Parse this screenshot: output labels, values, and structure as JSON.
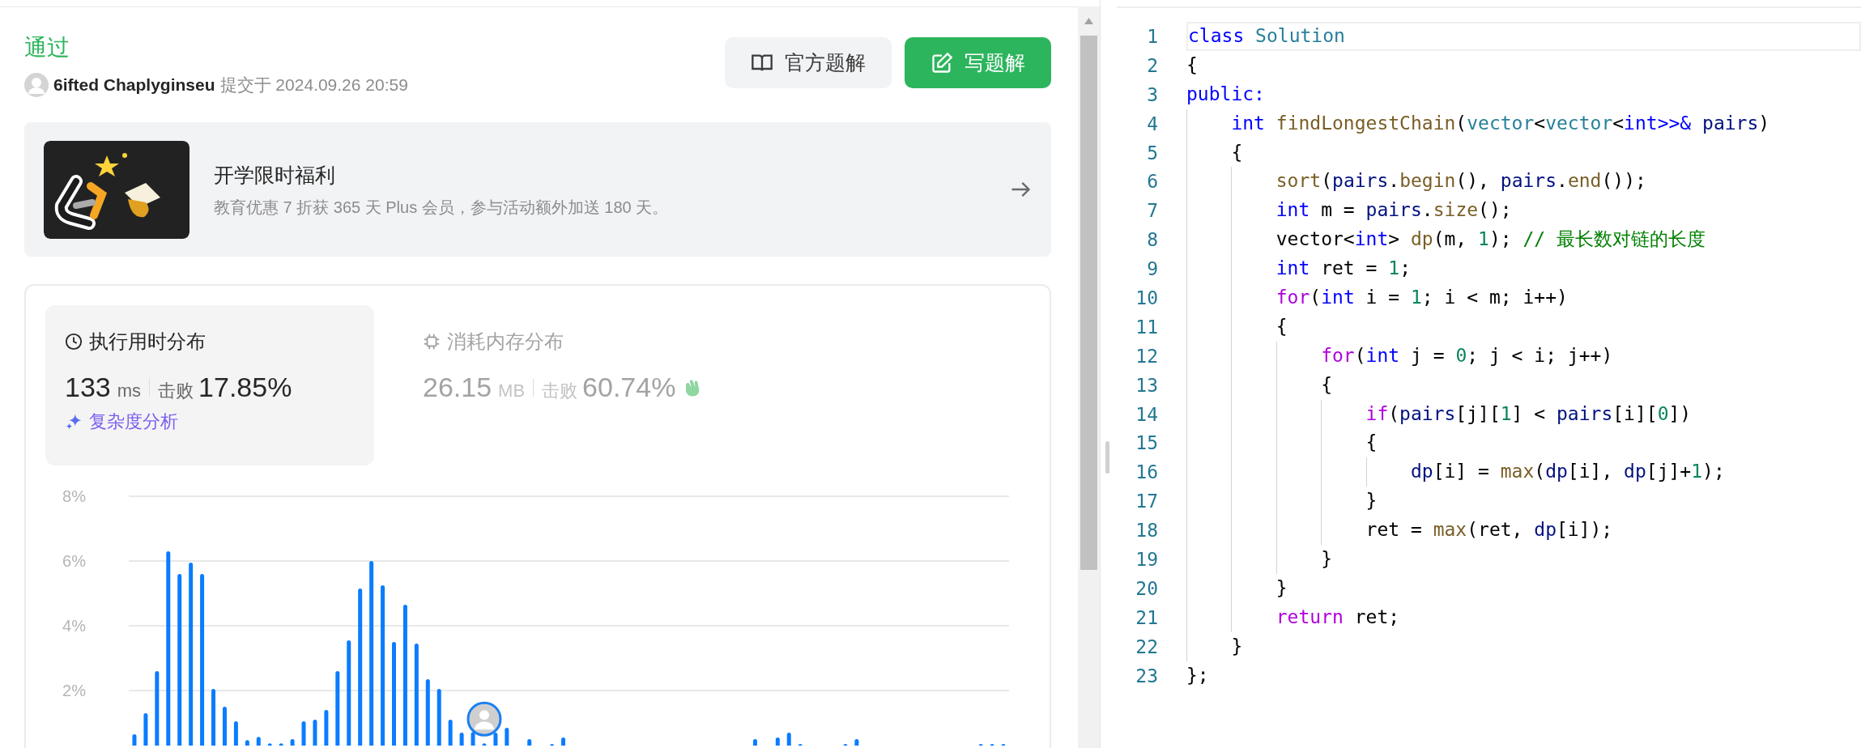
{
  "status": "通过",
  "submission": {
    "user": "6ifted Chaplyginseu",
    "submitted": "提交于 2024.09.26 20:59"
  },
  "actions": [
    {
      "label": "官方题解",
      "kind": "secondary"
    },
    {
      "label": "写题解",
      "kind": "primary"
    }
  ],
  "promo": {
    "kind": "picture",
    "title": "开学限时福利",
    "subtitle": "教育优惠 7 折获 365 天 Plus 会员，参与活动额外加送 180 天。"
  },
  "metrics": [
    {
      "kind": "runtime",
      "title": "执行用时分布",
      "selected": true,
      "value": "133",
      "unit": "ms",
      "beats_label": "击败",
      "beats": "17.85%",
      "link": "复杂度分析"
    },
    {
      "kind": "memory",
      "title": "消耗内存分布",
      "selected": false,
      "value": "26.15",
      "unit": "MB",
      "beats_label": "击败",
      "beats": "60.74%"
    }
  ],
  "distribution": {
    "chart_data": {
      "type": "bar",
      "values": [
        0.65,
        1.3,
        2.6,
        6.3,
        5.6,
        5.95,
        5.6,
        2.05,
        1.5,
        1.05,
        0.47,
        0.57,
        0.37,
        0.37,
        0.5,
        1.05,
        1.1,
        1.4,
        2.6,
        3.55,
        5.15,
        6.0,
        5.25,
        3.5,
        4.65,
        3.45,
        2.35,
        2.05,
        1.1,
        0.7,
        0.72,
        0.37,
        0.7,
        0.85,
        null,
        0.5,
        null,
        0.35,
        0.55,
        null,
        null,
        null,
        null,
        null,
        null,
        null,
        null,
        null,
        null,
        null,
        null,
        null,
        null,
        null,
        null,
        0.5,
        null,
        0.55,
        0.7,
        0.35,
        null,
        null,
        null,
        0.35,
        0.5,
        null,
        null,
        null,
        null,
        null,
        null,
        null,
        null,
        null,
        null,
        0.35,
        0.35,
        0.35
      ],
      "ylim": [
        0,
        8
      ],
      "yticks": [
        {
          "value": 2,
          "label": "2%"
        },
        {
          "value": 4,
          "label": "4%"
        },
        {
          "value": 6,
          "label": "6%"
        },
        {
          "value": 8,
          "label": "8%"
        }
      ],
      "grid": true
    }
  },
  "code": {
    "lines": [
      {
        "number": "1",
        "current": true,
        "tokens": [
          {
            "text": "class",
            "kind": "keyword"
          },
          {
            "text": " Solution",
            "kind": "type"
          }
        ]
      },
      {
        "number": "2",
        "current": false,
        "tokens": [
          {
            "text": "{",
            "kind": "plain"
          }
        ]
      },
      {
        "number": "3",
        "current": false,
        "tokens": [
          {
            "text": "public:",
            "kind": "keyword"
          }
        ]
      },
      {
        "number": "4",
        "current": false,
        "tokens": [
          {
            "text": "    int",
            "kind": "keyword"
          },
          {
            "text": " findLongestChain",
            "kind": "function"
          },
          {
            "text": "(",
            "kind": "plain"
          },
          {
            "text": "vector",
            "kind": "type"
          },
          {
            "text": "<",
            "kind": "plain"
          },
          {
            "text": "vector",
            "kind": "type"
          },
          {
            "text": "<",
            "kind": "plain"
          },
          {
            "text": "int",
            "kind": "keyword"
          },
          {
            "text": ">>& ",
            "kind": "keyword"
          },
          {
            "text": "pairs",
            "kind": "variable"
          },
          {
            "text": ")",
            "kind": "plain"
          }
        ]
      },
      {
        "number": "5",
        "current": false,
        "tokens": [
          {
            "text": "    {",
            "kind": "plain"
          }
        ]
      },
      {
        "number": "6",
        "current": false,
        "tokens": [
          {
            "text": "        sort",
            "kind": "function"
          },
          {
            "text": "(",
            "kind": "plain"
          },
          {
            "text": "pairs",
            "kind": "variable"
          },
          {
            "text": ".",
            "kind": "plain"
          },
          {
            "text": "begin",
            "kind": "function"
          },
          {
            "text": "(), ",
            "kind": "plain"
          },
          {
            "text": "pairs",
            "kind": "variable"
          },
          {
            "text": ".",
            "kind": "plain"
          },
          {
            "text": "end",
            "kind": "function"
          },
          {
            "text": "());",
            "kind": "plain"
          }
        ]
      },
      {
        "number": "7",
        "current": false,
        "tokens": [
          {
            "text": "        int",
            "kind": "keyword"
          },
          {
            "text": " m = ",
            "kind": "plain"
          },
          {
            "text": "pairs",
            "kind": "variable"
          },
          {
            "text": ".",
            "kind": "plain"
          },
          {
            "text": "size",
            "kind": "function"
          },
          {
            "text": "();",
            "kind": "plain"
          }
        ]
      },
      {
        "number": "8",
        "current": false,
        "tokens": [
          {
            "text": "        vector<",
            "kind": "plain"
          },
          {
            "text": "int",
            "kind": "keyword"
          },
          {
            "text": "> ",
            "kind": "plain"
          },
          {
            "text": "dp",
            "kind": "function"
          },
          {
            "text": "(m, ",
            "kind": "plain"
          },
          {
            "text": "1",
            "kind": "number"
          },
          {
            "text": "); ",
            "kind": "plain"
          },
          {
            "text": "// 最长数对链的长度",
            "kind": "comment"
          }
        ]
      },
      {
        "number": "9",
        "current": false,
        "tokens": [
          {
            "text": "        int",
            "kind": "keyword"
          },
          {
            "text": " ret = ",
            "kind": "plain"
          },
          {
            "text": "1",
            "kind": "number"
          },
          {
            "text": ";",
            "kind": "plain"
          }
        ]
      },
      {
        "number": "10",
        "current": false,
        "tokens": [
          {
            "text": "        for",
            "kind": "control"
          },
          {
            "text": "(",
            "kind": "plain"
          },
          {
            "text": "int",
            "kind": "keyword"
          },
          {
            "text": " i = ",
            "kind": "plain"
          },
          {
            "text": "1",
            "kind": "number"
          },
          {
            "text": "; i < m; i++)",
            "kind": "plain"
          }
        ]
      },
      {
        "number": "11",
        "current": false,
        "tokens": [
          {
            "text": "        {",
            "kind": "plain"
          }
        ]
      },
      {
        "number": "12",
        "current": false,
        "tokens": [
          {
            "text": "            for",
            "kind": "control"
          },
          {
            "text": "(",
            "kind": "plain"
          },
          {
            "text": "int",
            "kind": "keyword"
          },
          {
            "text": " j = ",
            "kind": "plain"
          },
          {
            "text": "0",
            "kind": "number"
          },
          {
            "text": "; j < i; j++)",
            "kind": "plain"
          }
        ]
      },
      {
        "number": "13",
        "current": false,
        "tokens": [
          {
            "text": "            {",
            "kind": "plain"
          }
        ]
      },
      {
        "number": "14",
        "current": false,
        "tokens": [
          {
            "text": "                if",
            "kind": "control"
          },
          {
            "text": "(",
            "kind": "plain"
          },
          {
            "text": "pairs",
            "kind": "variable"
          },
          {
            "text": "[j][",
            "kind": "plain"
          },
          {
            "text": "1",
            "kind": "number"
          },
          {
            "text": "] < ",
            "kind": "plain"
          },
          {
            "text": "pairs",
            "kind": "variable"
          },
          {
            "text": "[i][",
            "kind": "plain"
          },
          {
            "text": "0",
            "kind": "number"
          },
          {
            "text": "])",
            "kind": "plain"
          }
        ]
      },
      {
        "number": "15",
        "current": false,
        "tokens": [
          {
            "text": "                {",
            "kind": "plain"
          }
        ]
      },
      {
        "number": "16",
        "current": false,
        "tokens": [
          {
            "text": "                    dp",
            "kind": "variable"
          },
          {
            "text": "[i] = ",
            "kind": "plain"
          },
          {
            "text": "max",
            "kind": "function"
          },
          {
            "text": "(",
            "kind": "plain"
          },
          {
            "text": "dp",
            "kind": "variable"
          },
          {
            "text": "[i], ",
            "kind": "plain"
          },
          {
            "text": "dp",
            "kind": "variable"
          },
          {
            "text": "[j]+",
            "kind": "plain"
          },
          {
            "text": "1",
            "kind": "number"
          },
          {
            "text": ");",
            "kind": "plain"
          }
        ]
      },
      {
        "number": "17",
        "current": false,
        "tokens": [
          {
            "text": "                }",
            "kind": "plain"
          }
        ]
      },
      {
        "number": "18",
        "current": false,
        "tokens": [
          {
            "text": "                ret = ",
            "kind": "plain"
          },
          {
            "text": "max",
            "kind": "function"
          },
          {
            "text": "(ret, ",
            "kind": "plain"
          },
          {
            "text": "dp",
            "kind": "variable"
          },
          {
            "text": "[i]);",
            "kind": "plain"
          }
        ]
      },
      {
        "number": "19",
        "current": false,
        "tokens": [
          {
            "text": "            }",
            "kind": "plain"
          }
        ]
      },
      {
        "number": "20",
        "current": false,
        "tokens": [
          {
            "text": "        }",
            "kind": "plain"
          }
        ]
      },
      {
        "number": "21",
        "current": false,
        "tokens": [
          {
            "text": "        return",
            "kind": "control"
          },
          {
            "text": " ret;",
            "kind": "plain"
          }
        ]
      },
      {
        "number": "22",
        "current": false,
        "tokens": [
          {
            "text": "    }",
            "kind": "plain"
          }
        ]
      },
      {
        "number": "23",
        "current": false,
        "tokens": [
          {
            "text": "};",
            "kind": "plain"
          }
        ]
      }
    ]
  }
}
